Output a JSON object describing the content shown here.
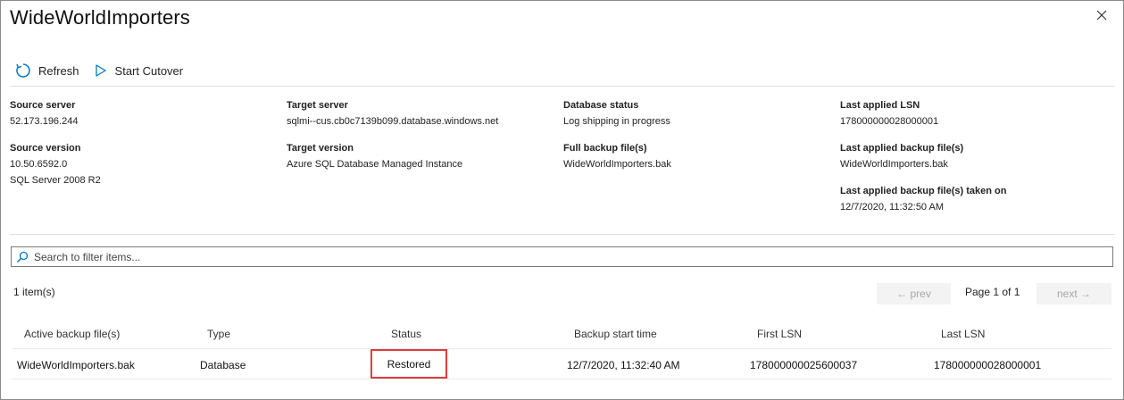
{
  "window": {
    "title": "WideWorldImporters"
  },
  "toolbar": {
    "refresh_label": "Refresh",
    "cutover_label": "Start Cutover"
  },
  "details": {
    "source_server_label": "Source server",
    "source_server": "52.173.196.244",
    "source_version_label": "Source version",
    "source_version": "10.50.6592.0",
    "source_version_name": "SQL Server 2008 R2",
    "target_server_label": "Target server",
    "target_server": "sqlmi--cus.cb0c7139b099.database.windows.net",
    "target_version_label": "Target version",
    "target_version": "Azure SQL Database Managed Instance",
    "db_status_label": "Database status",
    "db_status": "Log shipping in progress",
    "full_backup_label": "Full backup file(s)",
    "full_backup": "WideWorldImporters.bak",
    "last_lsn_label": "Last applied LSN",
    "last_lsn": "178000000028000001",
    "last_backup_label": "Last applied backup file(s)",
    "last_backup": "WideWorldImporters.bak",
    "last_backup_taken_label": "Last applied backup file(s) taken on",
    "last_backup_taken": "12/7/2020, 11:32:50 AM"
  },
  "search": {
    "placeholder": "Search to filter items..."
  },
  "list": {
    "count": "1 item(s)",
    "prev_label": "← prev",
    "page_text": "Page 1 of 1",
    "next_label": "next →"
  },
  "table": {
    "headers": [
      "Active backup file(s)",
      "Type",
      "Status",
      "Backup start time",
      "First LSN",
      "Last LSN"
    ],
    "rows": [
      [
        "WideWorldImporters.bak",
        "Database",
        "Restored",
        "12/7/2020, 11:32:40 AM",
        "178000000025600037",
        "178000000028000001"
      ]
    ]
  },
  "colors": {
    "accent": "#0078d4",
    "highlight": "#e03b3b"
  }
}
